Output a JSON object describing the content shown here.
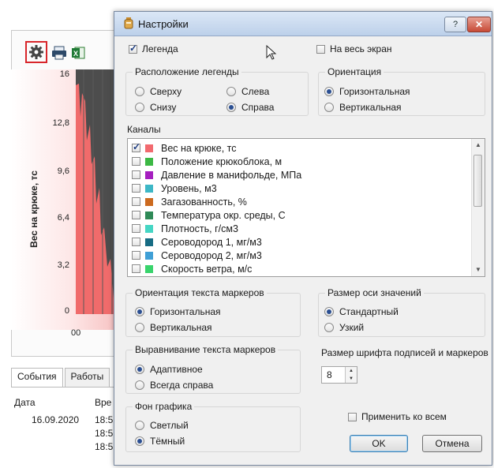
{
  "background": {
    "y_axis_label": "Вес на крюке, тс",
    "y_ticks": [
      "16",
      "12,8",
      "9,6",
      "6,4",
      "3,2",
      "0"
    ],
    "x_tick": "00",
    "tabs": [
      "События",
      "Работы"
    ],
    "table": {
      "headers": [
        "Дата",
        "Вре"
      ],
      "date": "16.09.2020",
      "times": [
        "18:5",
        "18:5",
        "18:5"
      ]
    },
    "icons": [
      "gear-icon",
      "printer-icon",
      "excel-icon"
    ]
  },
  "dialog": {
    "title": "Настройки",
    "help_label": "?",
    "close_label": "✕",
    "legend_checkbox": "Легенда",
    "fullscreen_checkbox": "На весь экран",
    "legend_position": {
      "title": "Расположение легенды",
      "options": [
        "Сверху",
        "Слева",
        "Снизу",
        "Справа"
      ],
      "selected": "Справа"
    },
    "orientation": {
      "title": "Ориентация",
      "options": [
        "Горизонтальная",
        "Вертикальная"
      ],
      "selected": "Горизонтальная"
    },
    "channels_label": "Каналы",
    "channels": [
      {
        "name": "Вес на крюке, тс",
        "color": "#f26a6f",
        "checked": true
      },
      {
        "name": "Положение крюкоблока, м",
        "color": "#3cb844",
        "checked": false
      },
      {
        "name": "Давление в манифольде, МПа",
        "color": "#a51fbf",
        "checked": false
      },
      {
        "name": "Уровень, м3",
        "color": "#3db7c6",
        "checked": false
      },
      {
        "name": "Загазованность, %",
        "color": "#cc6a1f",
        "checked": false
      },
      {
        "name": "Температура окр. среды, С",
        "color": "#2f8a57",
        "checked": false
      },
      {
        "name": "Плотность, г/см3",
        "color": "#45d6c4",
        "checked": false
      },
      {
        "name": "Сероводород 1, мг/м3",
        "color": "#176c84",
        "checked": false
      },
      {
        "name": "Сероводород 2, мг/м3",
        "color": "#3f9fd6",
        "checked": false
      },
      {
        "name": "Скорость ветра, м/с",
        "color": "#39d46c",
        "checked": false
      }
    ],
    "marker_text_orientation": {
      "title": "Ориентация текста маркеров",
      "options": [
        "Горизонтальная",
        "Вертикальная"
      ],
      "selected": "Горизонтальная"
    },
    "axis_size": {
      "title": "Размер оси значений",
      "options": [
        "Стандартный",
        "Узкий"
      ],
      "selected": "Стандартный"
    },
    "marker_text_alignment": {
      "title": "Выравнивание текста маркеров",
      "options": [
        "Адаптивное",
        "Всегда справа"
      ],
      "selected": "Адаптивное"
    },
    "font_size": {
      "label": "Размер шрифта подписей и маркеров",
      "value": "8"
    },
    "chart_background": {
      "title": "Фон графика",
      "options": [
        "Светлый",
        "Тёмный"
      ],
      "selected": "Тёмный"
    },
    "apply_all_checkbox": "Применить ко всем",
    "ok_label": "OK",
    "cancel_label": "Отмена"
  }
}
